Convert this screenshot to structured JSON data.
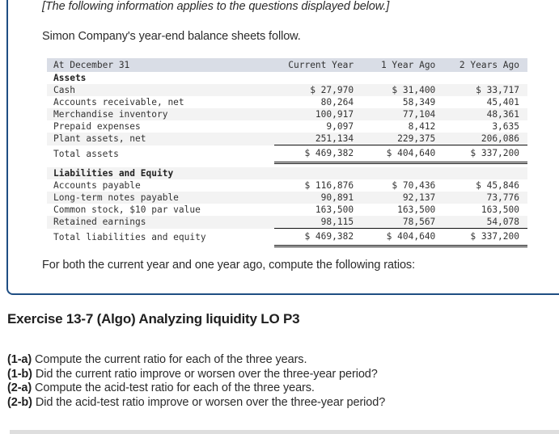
{
  "intro": {
    "note": "[The following information applies to the questions displayed below.]",
    "text": "Simon Company's year-end balance sheets follow."
  },
  "balance_sheet": {
    "header": {
      "label": "At December 31",
      "columns": [
        "Current Year",
        "1 Year Ago",
        "2 Years Ago"
      ]
    },
    "assets": {
      "section_label": "Assets",
      "rows": [
        {
          "label": "Cash",
          "values": [
            "$ 27,970",
            "$ 31,400",
            "$ 33,717"
          ]
        },
        {
          "label": "Accounts receivable, net",
          "values": [
            "80,264",
            "58,349",
            "45,401"
          ]
        },
        {
          "label": "Merchandise inventory",
          "values": [
            "100,917",
            "77,104",
            "48,361"
          ]
        },
        {
          "label": "Prepaid expenses",
          "values": [
            "9,097",
            "8,412",
            "3,635"
          ]
        },
        {
          "label": "Plant assets, net",
          "values": [
            "251,134",
            "229,375",
            "206,086"
          ]
        }
      ],
      "total": {
        "label": "Total assets",
        "values": [
          "$ 469,382",
          "$ 404,640",
          "$ 337,200"
        ]
      }
    },
    "liabilities_equity": {
      "section_label": "Liabilities and Equity",
      "rows": [
        {
          "label": "Accounts payable",
          "values": [
            "$ 116,876",
            "$ 70,436",
            "$ 45,846"
          ]
        },
        {
          "label": "Long-term notes payable",
          "values": [
            "90,891",
            "92,137",
            "73,776"
          ]
        },
        {
          "label": "Common stock, $10 par value",
          "values": [
            "163,500",
            "163,500",
            "163,500"
          ]
        },
        {
          "label": "Retained earnings",
          "values": [
            "98,115",
            "78,567",
            "54,078"
          ]
        }
      ],
      "total": {
        "label": "Total liabilities and equity",
        "values": [
          "$ 469,382",
          "$ 404,640",
          "$ 337,200"
        ]
      }
    }
  },
  "ratios_prompt": "For both the current year and one year ago, compute the following ratios:",
  "exercise": {
    "title": "Exercise 13-7 (Algo) Analyzing liquidity LO P3",
    "questions": [
      {
        "id": "(1-a)",
        "text": " Compute the current ratio for each of the three years."
      },
      {
        "id": "(1-b)",
        "text": " Did the current ratio improve or worsen over the three-year period?"
      },
      {
        "id": "(2-a)",
        "text": " Compute the acid-test ratio for each of the three years."
      },
      {
        "id": "(2-b)",
        "text": " Did the acid-test ratio improve or worsen over the three-year period?"
      }
    ]
  },
  "colors": {
    "panel_border": "#1f4e83",
    "table_header_bg": "#d9dde6",
    "row_stripe_bg": "#f3f3f3"
  }
}
